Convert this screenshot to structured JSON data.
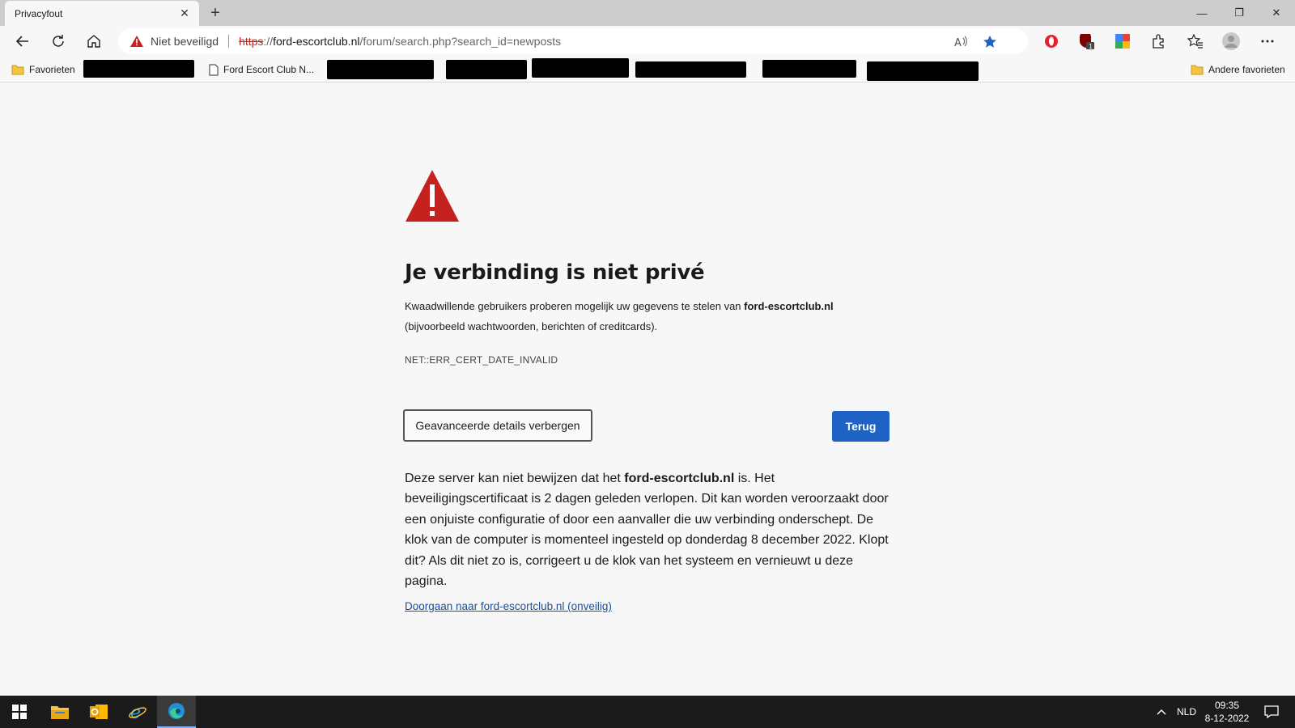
{
  "tab": {
    "title": "Privacyfout",
    "close_symbol": "✕"
  },
  "newtab_symbol": "+",
  "window": {
    "minimize": "—",
    "restore": "❐",
    "close": "✕"
  },
  "omnibox": {
    "security_label": "Niet beveiligd",
    "url_scheme": "https",
    "url_sep": "://",
    "url_host": "ford-escortclub.nl",
    "url_path": "/forum/search.php?search_id=newposts"
  },
  "bookmarks": {
    "favorites_label": "Favorieten",
    "item_label": "Ford Escort Club N...",
    "other_favorites_label": "Andere favorieten"
  },
  "page": {
    "heading": "Je verbinding is niet privé",
    "message_before": "Kwaadwillende gebruikers proberen mogelijk uw gegevens te stelen van ",
    "message_host": "ford-escortclub.nl",
    "message_after": " (bijvoorbeeld wachtwoorden, berichten of creditcards).",
    "error_code": "NET::ERR_CERT_DATE_INVALID",
    "advanced_button": "Geavanceerde details verbergen",
    "back_button": "Terug",
    "detail_before": "Deze server kan niet bewijzen dat het ",
    "detail_host": "ford-escortclub.nl",
    "detail_after": " is. Het beveiligingscertificaat is 2 dagen geleden verlopen. Dit kan worden veroorzaakt door een onjuiste configuratie of door een aanvaller die uw verbinding onderschept. De klok van de computer is momenteel ingesteld op donderdag 8 december 2022. Klopt dit? Als dit niet zo is, corrigeert u de klok van het systeem en vernieuwt u deze pagina.",
    "proceed_link": "Doorgaan naar ford-escortclub.nl (onveilig)"
  },
  "taskbar": {
    "language": "NLD",
    "time": "09:35",
    "date": "8-12-2022"
  },
  "colors": {
    "accent": "#1e63c4",
    "warning_red": "#c5221f",
    "link": "#1a4fa0"
  }
}
